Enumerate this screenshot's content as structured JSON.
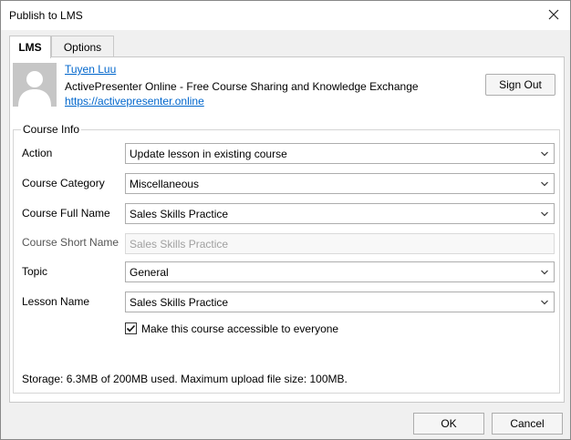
{
  "window": {
    "title": "Publish to LMS"
  },
  "tabs": [
    {
      "label": "LMS",
      "active": true
    },
    {
      "label": "Options",
      "active": false
    }
  ],
  "account": {
    "user_name": "Tuyen Luu",
    "site_name": "ActivePresenter Online - Free Course Sharing and Knowledge Exchange",
    "site_url": "https://activepresenter.online",
    "sign_out_label": "Sign Out",
    "avatar_icon": "user-avatar-icon"
  },
  "course_info": {
    "group_title": "Course Info",
    "fields": [
      {
        "label": "Action",
        "value": "Update lesson in existing course",
        "type": "dropdown"
      },
      {
        "label": "Course Category",
        "value": "Miscellaneous",
        "type": "dropdown"
      },
      {
        "label": "Course Full Name",
        "value": "Sales Skills Practice",
        "type": "dropdown"
      },
      {
        "label": "Course Short Name",
        "value": "Sales Skills Practice",
        "type": "text-disabled"
      },
      {
        "label": "Topic",
        "value": "General",
        "type": "dropdown"
      },
      {
        "label": "Lesson Name",
        "value": "Sales Skills Practice",
        "type": "dropdown"
      }
    ],
    "accessible_checkbox": {
      "label": "Make this course accessible to everyone",
      "checked": true
    },
    "storage": "Storage: 6.3MB of 200MB used. Maximum upload file size: 100MB."
  },
  "footer": {
    "ok_label": "OK",
    "cancel_label": "Cancel"
  },
  "colors": {
    "link": "#0066cc",
    "border": "#adadad",
    "window_bg": "#f0f0f0"
  }
}
